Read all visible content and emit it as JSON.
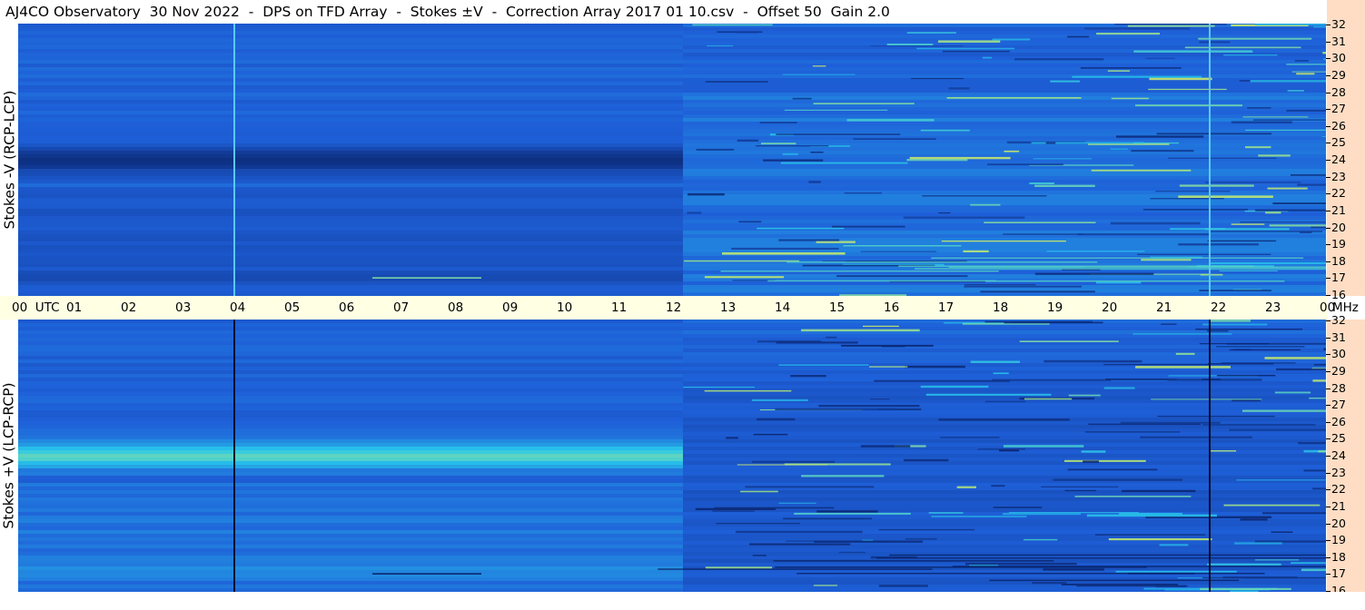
{
  "title": "AJ4CO Observatory  30 Nov 2022  -  DPS on TFD Array  -  Stokes ±V  -  Correction Array 2017 01 10.csv  -  Offset 50  Gain 2.0",
  "time_axis": {
    "labels": [
      "00  UTC",
      "01",
      "02",
      "03",
      "04",
      "05",
      "06",
      "07",
      "08",
      "09",
      "10",
      "11",
      "12",
      "13",
      "14",
      "15",
      "16",
      "17",
      "18",
      "19",
      "20",
      "21",
      "22",
      "23",
      "00"
    ],
    "unit": "MHz"
  },
  "colors": {
    "background": "#ffffff",
    "axis_band": "#ffffe4",
    "freq_strip": "#ffddc4",
    "colormap_low": "#061a5a",
    "colormap_mid": "#1e5fd8",
    "colormap_high": "#d8f060"
  },
  "chart_data": [
    {
      "type": "heatmap",
      "panel": "top",
      "ylabel": "Stokes -V  (RCP-LCP)",
      "xlabel": "UTC",
      "x_range_hours": [
        0,
        24
      ],
      "y_range_mhz": [
        16,
        32
      ],
      "y_ticks": [
        32,
        31,
        30,
        29,
        28,
        27,
        26,
        25,
        24,
        23,
        22,
        21,
        20,
        19,
        18,
        17,
        16
      ],
      "features": {
        "dark_band_center_mhz": 24,
        "dark_band_end_hour": 12.2,
        "lighter_activity_from_hour": 12.2,
        "vertical_line_hours": [
          3.95,
          21.85
        ],
        "vertical_line_color": "light"
      }
    },
    {
      "type": "heatmap",
      "panel": "bottom",
      "ylabel": "Stokes +V  (LCP-RCP)",
      "xlabel": "UTC",
      "x_range_hours": [
        0,
        24
      ],
      "y_range_mhz": [
        16,
        32
      ],
      "y_ticks": [
        32,
        31,
        30,
        29,
        28,
        27,
        26,
        25,
        24,
        23,
        22,
        21,
        20,
        19,
        18,
        17,
        16
      ],
      "features": {
        "bright_band_center_mhz": 24,
        "bright_band_end_hour": 12.2,
        "darker_activity_from_hour": 12.2,
        "vertical_line_hours": [
          3.95,
          21.85
        ],
        "vertical_line_color": "dark"
      }
    }
  ]
}
